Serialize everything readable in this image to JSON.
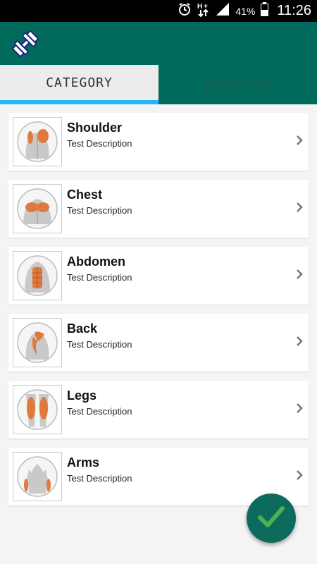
{
  "status_bar": {
    "battery_percent": "41%",
    "time": "11:26",
    "icons": [
      "alarm-icon",
      "data-transfer-icon",
      "signal-icon",
      "battery-icon"
    ]
  },
  "app_bar": {
    "logo_icon": "dumbbell-icon",
    "color": "#006b5c"
  },
  "tabs": [
    {
      "label": "CATEGORY",
      "selected": true
    },
    {
      "label": "EXERCISE",
      "selected": false
    }
  ],
  "categories": [
    {
      "title": "Shoulder",
      "description": "Test Description",
      "icon": "shoulder-muscle-icon"
    },
    {
      "title": "Chest",
      "description": "Test Description",
      "icon": "chest-muscle-icon"
    },
    {
      "title": "Abdomen",
      "description": "Test Description",
      "icon": "abdomen-muscle-icon"
    },
    {
      "title": "Back",
      "description": "Test Description",
      "icon": "back-muscle-icon"
    },
    {
      "title": "Legs",
      "description": "Test Description",
      "icon": "legs-muscle-icon"
    },
    {
      "title": "Arms",
      "description": "Test Description",
      "icon": "arms-muscle-icon"
    }
  ],
  "fab": {
    "icon": "checkmark-icon",
    "color": "#0d6b5e",
    "check_color": "#4caf50"
  },
  "colors": {
    "accent": "#29b6f6",
    "primary": "#006b5c",
    "muscle": "#e07a3c"
  }
}
